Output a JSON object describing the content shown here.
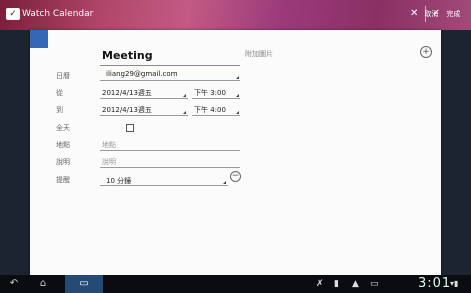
{
  "titlebar": {
    "app_title": "Watch Calendar",
    "cancel_label": "取消",
    "save_label": "完成"
  },
  "event": {
    "title": "Meeting",
    "attach_label": "附加圖片",
    "calendar_label": "日曆",
    "calendar_value": "iliang29@gmail.com",
    "from_label": "從",
    "from_date": "2012/4/13週五",
    "from_time": "下午 3:00",
    "to_label": "到",
    "to_date": "2012/4/13週五",
    "to_time": "下午 4:00",
    "allday_label": "全天",
    "location_label": "地點",
    "location_placeholder": "地點",
    "description_label": "說明",
    "description_placeholder": "說明",
    "reminder_label": "提醒",
    "reminder_value": "10 分鐘"
  },
  "navbar": {
    "clock": "3:01"
  },
  "colors": {
    "calendar_color": "#3268b7",
    "accent": "#4b9de0"
  }
}
